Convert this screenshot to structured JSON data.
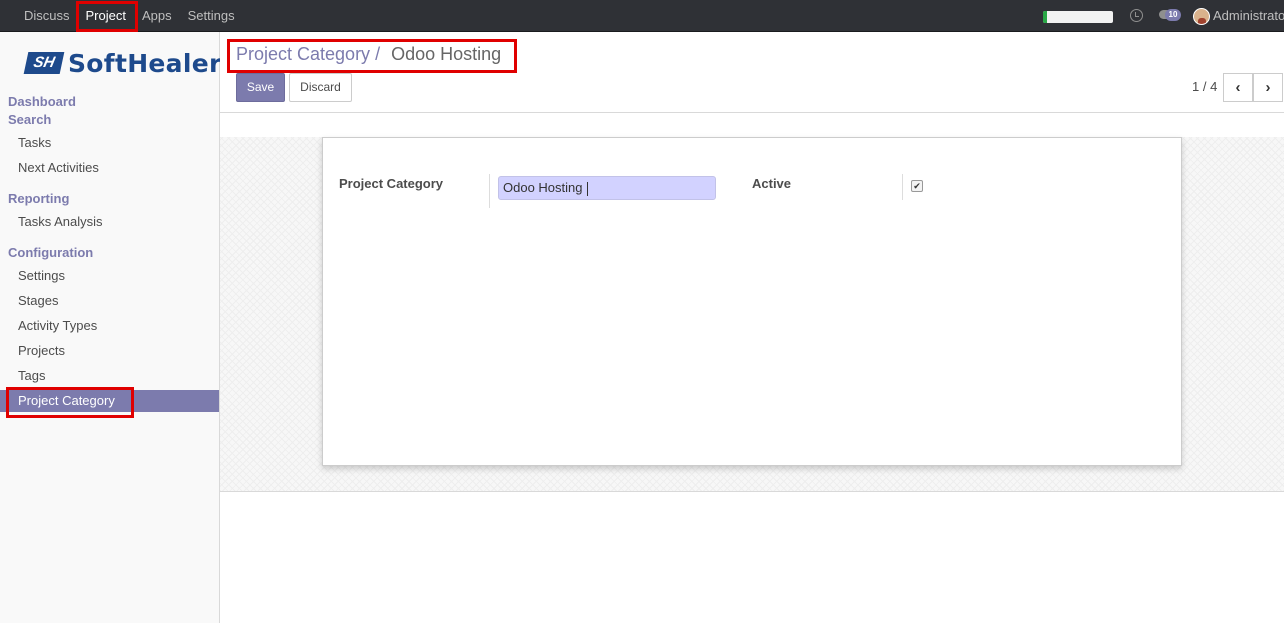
{
  "topbar": {
    "menu": [
      "Discuss",
      "Project",
      "Apps",
      "Settings"
    ],
    "active_menu": "Project",
    "user_name": "Administrator",
    "notification_count": "10",
    "progress_fraction": 0.06,
    "colors": {
      "bar": "#2f3136",
      "accent": "#7c7bad",
      "progress": "#28a745",
      "highlight": "#e00000"
    }
  },
  "sidebar": {
    "logo": {
      "mark": "SH",
      "text": "SoftHealer"
    },
    "sections": [
      {
        "title": "Dashboard",
        "items": []
      },
      {
        "title": "Search",
        "items": [
          "Tasks",
          "Next Activities"
        ]
      },
      {
        "title": "Reporting",
        "items": [
          "Tasks Analysis"
        ]
      },
      {
        "title": "Configuration",
        "items": [
          "Settings",
          "Stages",
          "Activity Types",
          "Projects",
          "Tags",
          "Project Category"
        ]
      }
    ],
    "active_item": "Project Category"
  },
  "control_panel": {
    "breadcrumb": {
      "parent": "Project Category",
      "separator": "/",
      "current": "Odoo Hosting"
    },
    "save_label": "Save",
    "discard_label": "Discard",
    "pager": {
      "value": "1 / 4",
      "prev_icon": "chevron-left-icon",
      "next_icon": "chevron-right-icon"
    }
  },
  "form": {
    "category_label": "Project Category",
    "category_value": "Odoo Hosting",
    "active_label": "Active",
    "active_checked": true
  }
}
